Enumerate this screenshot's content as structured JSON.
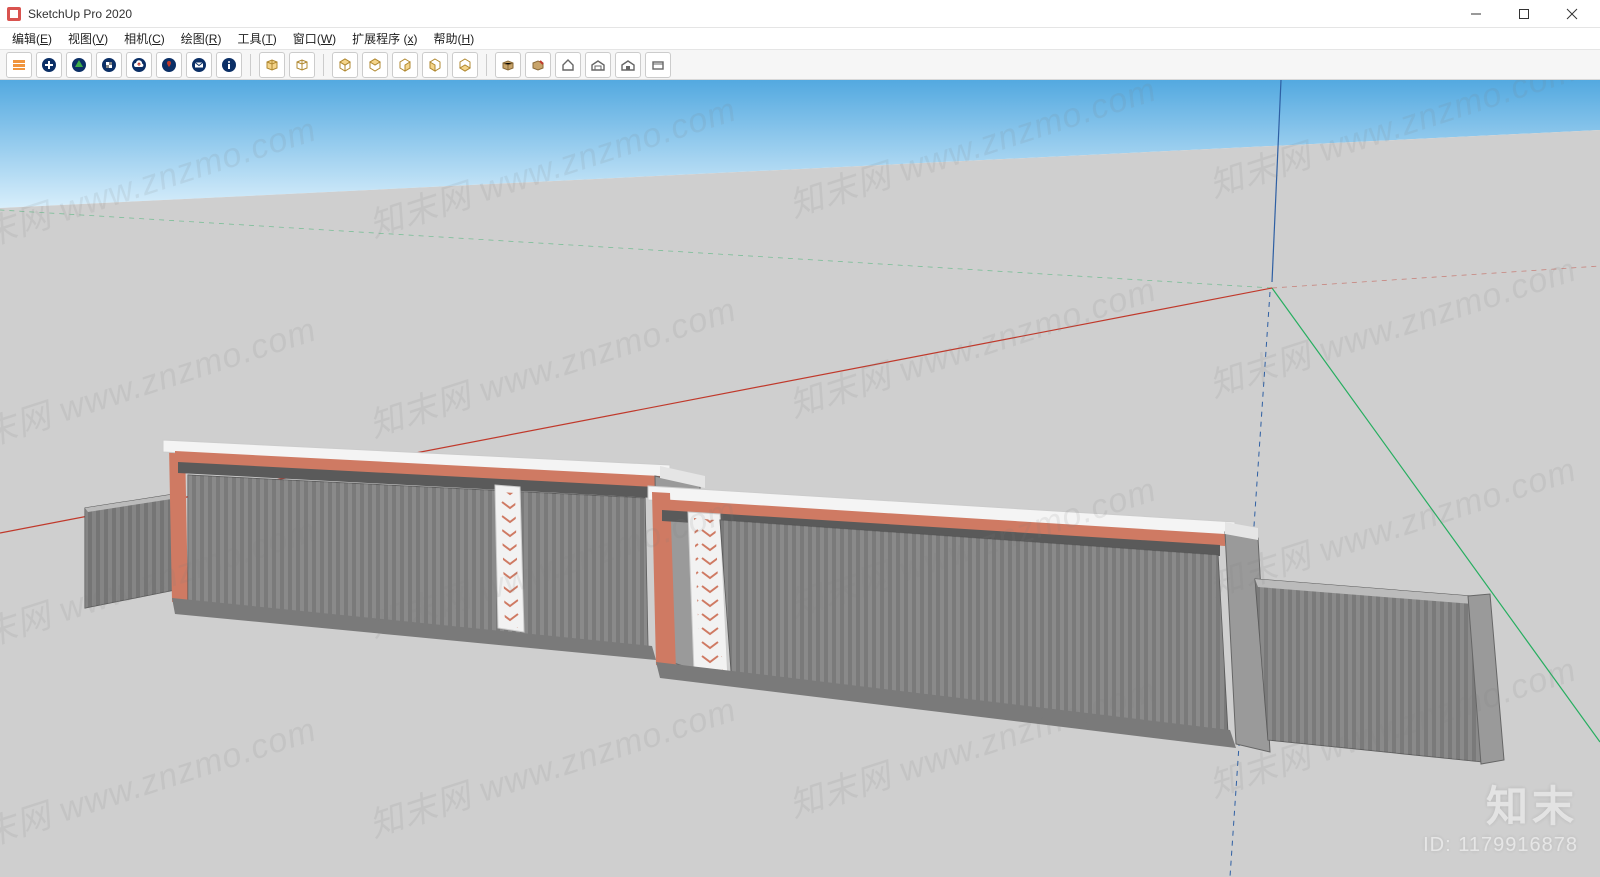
{
  "window": {
    "title": "SketchUp Pro 2020",
    "controls": {
      "minimize": "minimize",
      "maximize": "maximize",
      "close": "close"
    }
  },
  "menu": {
    "items": [
      {
        "label": "编辑",
        "accel": "E"
      },
      {
        "label": "视图",
        "accel": "V"
      },
      {
        "label": "相机",
        "accel": "C"
      },
      {
        "label": "绘图",
        "accel": "R"
      },
      {
        "label": "工具",
        "accel": "T"
      },
      {
        "label": "窗口",
        "accel": "W"
      },
      {
        "label": "扩展程序",
        "accel": "x"
      },
      {
        "label": "帮助",
        "accel": "H"
      }
    ]
  },
  "toolbar": {
    "groups": [
      [
        "layers-icon",
        "add-icon",
        "tree-icon",
        "materials-icon",
        "cloud-upload-icon",
        "pin-icon",
        "mail-icon",
        "info-icon"
      ],
      [
        "face-front-icon",
        "face-back-icon"
      ],
      [
        "iso-view-icon",
        "top-view-icon",
        "front-view-icon",
        "right-view-icon",
        "back-view-icon"
      ],
      [
        "components-icon",
        "component-edit-icon",
        "home-icon",
        "warehouse-icon",
        "warehouse-alt-icon",
        "box-icon"
      ]
    ],
    "icons": {
      "layers-icon": "layers",
      "add-icon": "add",
      "tree-icon": "tree",
      "materials-icon": "materials",
      "cloud-upload-icon": "cloud-upload",
      "pin-icon": "pin",
      "mail-icon": "mail",
      "info-icon": "info",
      "face-front-icon": "face-front",
      "face-back-icon": "face-back",
      "iso-view-icon": "iso",
      "top-view-icon": "top",
      "front-view-icon": "front",
      "right-view-icon": "right",
      "back-view-icon": "back",
      "components-icon": "components",
      "component-edit-icon": "component-edit",
      "home-icon": "home",
      "warehouse-icon": "warehouse",
      "warehouse-alt-icon": "warehouse-alt",
      "box-icon": "box"
    }
  },
  "viewport": {
    "axes": {
      "x_color": "#c0392b",
      "y_color": "#27ae60",
      "z_color": "#2e5fa3"
    },
    "sky_top": "#6eb7e8",
    "sky_bottom": "#d8eefb",
    "ground": "#cfcfcf",
    "model": {
      "accent": "#cf7a63",
      "fence_gray": "#7d7d7d",
      "white_band": "#f4f4f4"
    }
  },
  "watermark": {
    "repeat_text": "知末网 www.znzmo.com",
    "brand": "知末",
    "id_label": "ID:",
    "id_value": "1179916878"
  }
}
